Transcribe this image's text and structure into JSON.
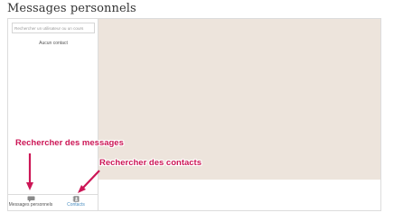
{
  "page": {
    "title": "Messages personnels"
  },
  "sidebar": {
    "search_placeholder": "Rechercher un utilisateur ou un cours",
    "empty_text": "Aucun contact",
    "nav": {
      "messages_label": "Messages personnels",
      "contacts_label": "Contacts"
    }
  },
  "annotations": {
    "search_messages": "Rechercher des messages",
    "search_contacts": "Rechercher des contacts"
  },
  "colors": {
    "annotation": "#cc1656",
    "conversation_background": "#ede4dc",
    "contacts_link": "#4a8ec0"
  },
  "icons": {
    "messages": "speech-bubble-icon",
    "contacts": "address-book-icon"
  }
}
